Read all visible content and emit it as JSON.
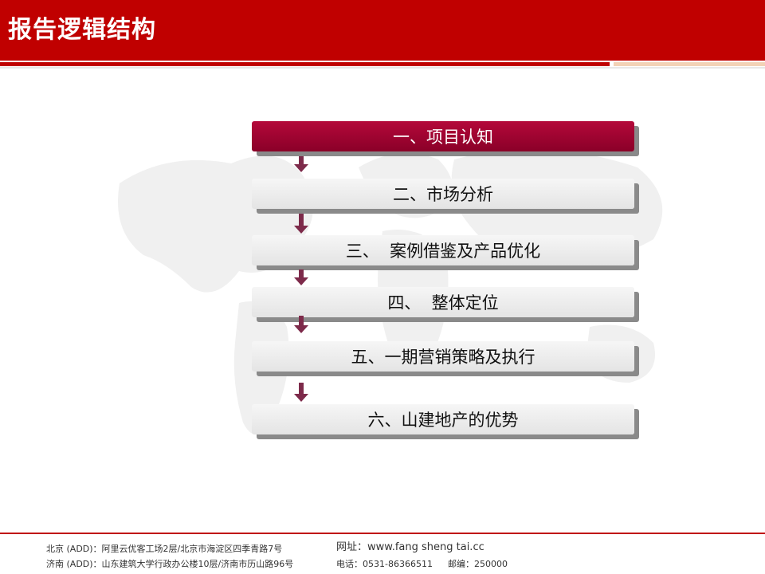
{
  "header": {
    "title": "报告逻辑结构",
    "colors": {
      "primary_red": "#c00000",
      "accent_tan": "#f2d2b6"
    }
  },
  "steps": [
    {
      "label": "一、项目认知",
      "active": true
    },
    {
      "label": "二、市场分析",
      "active": false
    },
    {
      "label": "三、  案例借鉴及产品优化",
      "active": false
    },
    {
      "label": "四、  整体定位",
      "active": false
    },
    {
      "label": "五、一期营销策略及执行",
      "active": false
    },
    {
      "label": "六、山建地产的优势",
      "active": false
    }
  ],
  "colors": {
    "active_step": "#9b0030",
    "inactive_step": "#ececec",
    "arrow": "#7d2a4a"
  },
  "footer": {
    "beijing": "北京 (ADD)：阿里云优客工场2层/北京市海淀区四季青路7号",
    "jinan": "济南 (ADD)：山东建筑大学行政办公楼10层/济南市历山路96号",
    "website": "网址：www.fang sheng tai.cc",
    "phone": "电话：0531-86366511",
    "postcode": "邮编：250000"
  }
}
